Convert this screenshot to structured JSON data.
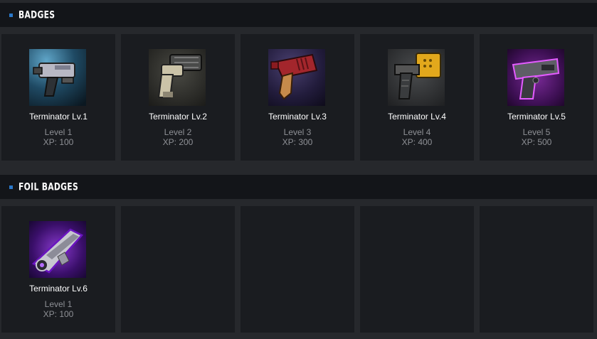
{
  "badges": {
    "title": "BADGES",
    "items": [
      {
        "name": "Terminator Lv.1",
        "level": "Level 1",
        "xp": "XP: 100",
        "icon": "blaster-lv1-icon"
      },
      {
        "name": "Terminator Lv.2",
        "level": "Level 2",
        "xp": "XP: 200",
        "icon": "blaster-lv2-icon"
      },
      {
        "name": "Terminator Lv.3",
        "level": "Level 3",
        "xp": "XP: 300",
        "icon": "blaster-lv3-icon"
      },
      {
        "name": "Terminator Lv.4",
        "level": "Level 4",
        "xp": "XP: 400",
        "icon": "blaster-lv4-icon"
      },
      {
        "name": "Terminator Lv.5",
        "level": "Level 5",
        "xp": "XP: 500",
        "icon": "blaster-lv5-icon"
      }
    ]
  },
  "foil_badges": {
    "title": "FOIL BADGES",
    "items": [
      {
        "name": "Terminator Lv.6",
        "level": "Level 1",
        "xp": "XP: 100",
        "icon": "blaster-foil-icon"
      }
    ]
  },
  "colors": {
    "page_bg": "#26282c",
    "header_bg": "#131519",
    "card_bg": "#1a1c20",
    "accent": "#2a78c9",
    "muted_text": "#8e9095"
  }
}
